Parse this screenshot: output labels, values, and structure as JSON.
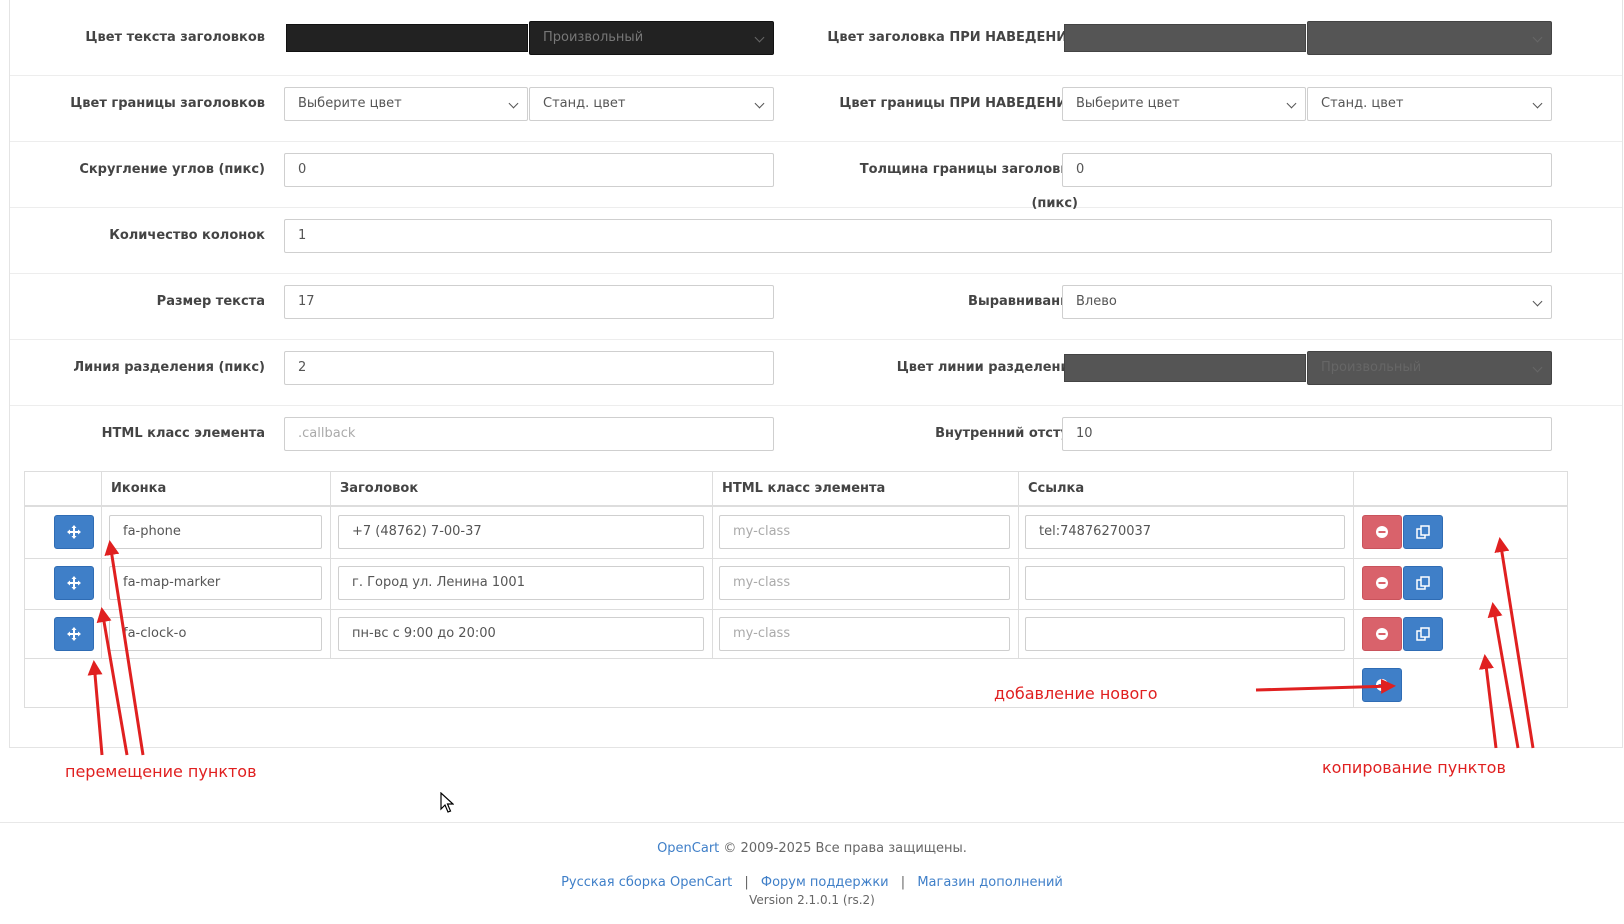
{
  "form": {
    "rows": [
      {
        "left_label": "Цвет текста заголовков",
        "left_swatch_color": "#222222",
        "left_select": "Произвольный",
        "right_label": "Цвет заголовка ПРИ НАВЕДЕНИИ",
        "right_swatch_color": "#555555",
        "right_select": ""
      },
      {
        "left_label": "Цвет границы заголовков",
        "left_select1": "Выберите цвет",
        "left_select2": "Станд. цвет",
        "right_label": "Цвет границы ПРИ НАВЕДЕНИИ",
        "right_select1": "Выберите цвет",
        "right_select2": "Станд. цвет"
      },
      {
        "left_label": "Скругление углов (пикс)",
        "left_value": "0",
        "right_label": "Толщина границы заголовка (пикс)",
        "right_value": "0"
      },
      {
        "left_label": "Количество колонок",
        "left_value": "1"
      },
      {
        "left_label": "Размер текста",
        "left_value": "17",
        "right_label": "Выравнивание",
        "right_select": "Влево"
      },
      {
        "left_label": "Линия разделения (пикс)",
        "left_value": "2",
        "right_label": "Цвет линии разделения",
        "right_swatch_color": "#555555",
        "right_select": "Произвольный"
      },
      {
        "left_label": "HTML класс элемента",
        "left_placeholder": ".callback",
        "right_label": "Внутренний отступ",
        "right_value": "10"
      }
    ]
  },
  "table": {
    "headers": [
      "Иконка",
      "Заголовок",
      "HTML класс элемента",
      "Ссылка"
    ],
    "rows": [
      {
        "icon": "fa-phone",
        "title": "+7 (48762) 7-00-37",
        "css_class": "",
        "css_placeholder": "my-class",
        "link": "tel:74876270037"
      },
      {
        "icon": "fa-map-marker",
        "title": "г. Город ул. Ленина 1001",
        "css_class": "",
        "css_placeholder": "my-class",
        "link": ""
      },
      {
        "icon": "fa-clock-o",
        "title": "пн-вс с 9:00 до 20:00",
        "css_class": "",
        "css_placeholder": "my-class",
        "link": ""
      }
    ]
  },
  "annotations": {
    "add_new": "добавление нового",
    "move_items": "перемещение пунктов",
    "copy_items": "копирование пунктов"
  },
  "footer": {
    "brand": "OpenCart",
    "copyright": " © 2009-2025 Все права защищены.",
    "links": [
      "Русская сборка OpenCart",
      "Форум поддержки",
      "Магазин дополнений"
    ],
    "separator": "|",
    "version": "Version 2.1.0.1 (rs.2)"
  },
  "colors": {
    "primary": "#3f7fc8",
    "danger": "#d9626b",
    "annotation": "#e02020"
  }
}
